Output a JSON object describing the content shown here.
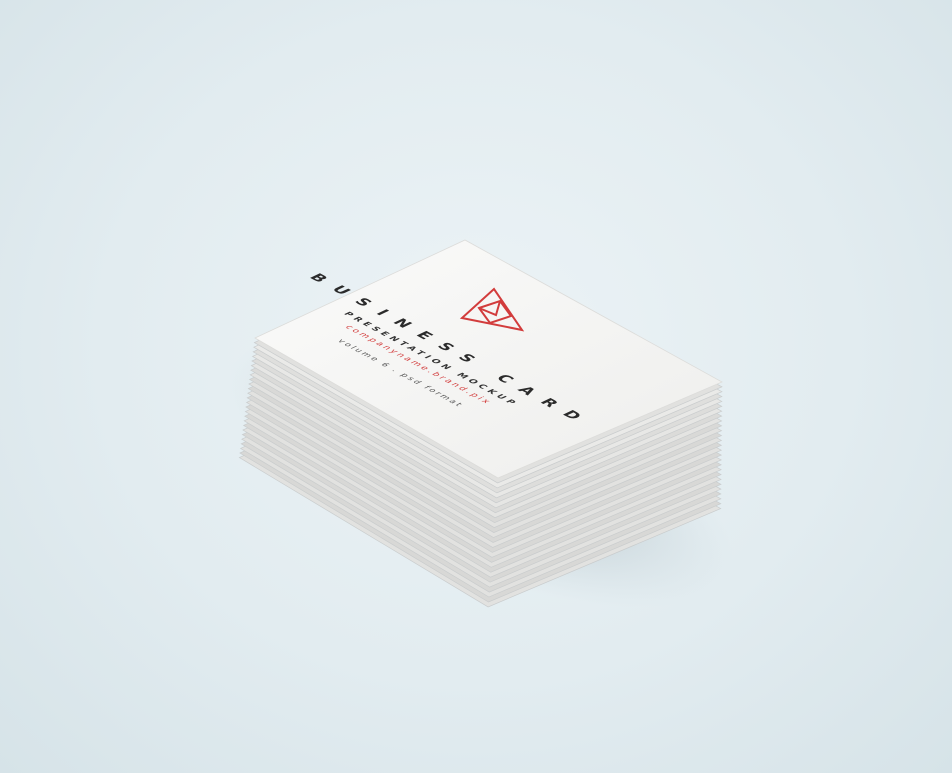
{
  "card": {
    "title": "BUSINESS CARD",
    "subtitle": "PRESENTATION MOCKUP",
    "website": "companyname.brand.pix",
    "note": "volume 6 . psd format"
  },
  "colors": {
    "background": "#e4edf1",
    "card_face": "#f4f4f2",
    "card_edge": "#e9e9e7",
    "title_text": "#2b2b2b",
    "accent_red": "#d23c3c"
  },
  "logo": {
    "icon": "triangle-envelope-logo"
  }
}
